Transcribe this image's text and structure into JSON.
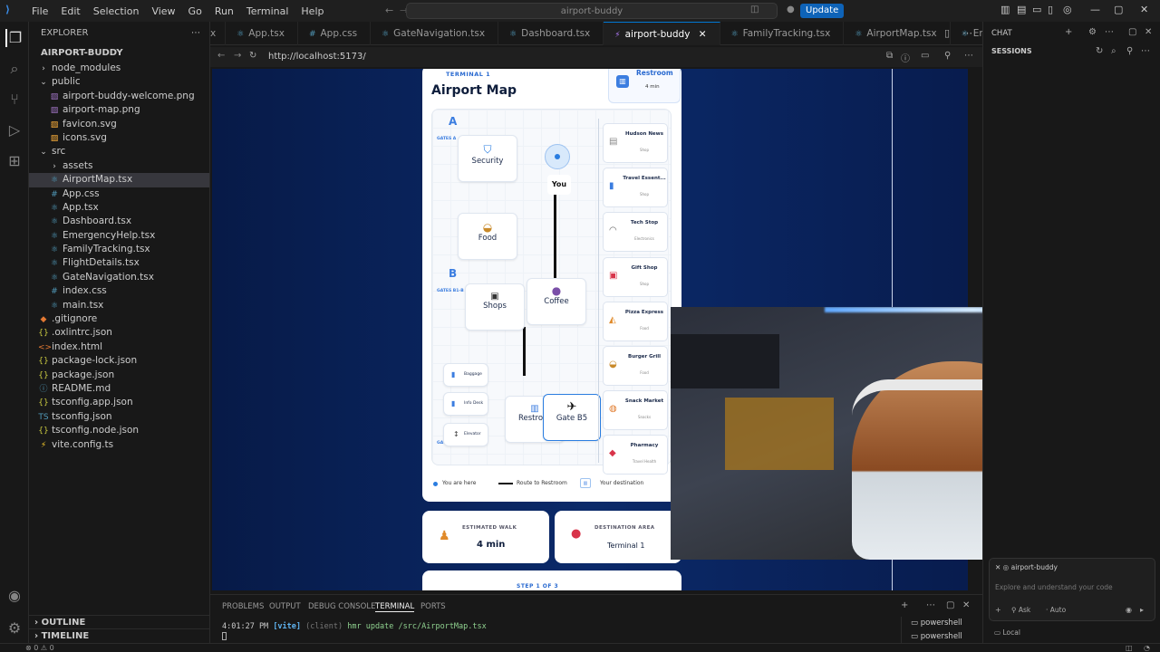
{
  "titlebar": {
    "menu": [
      "File",
      "Edit",
      "Selection",
      "View",
      "Go",
      "Run",
      "Terminal",
      "Help"
    ],
    "search": "airport-buddy",
    "update": "Update"
  },
  "explorer": {
    "header": "EXPLORER",
    "project": "AIRPORT-BUDDY",
    "items": [
      {
        "label": "node_modules",
        "depth": 1,
        "kind": "folder-closed"
      },
      {
        "label": "public",
        "depth": 1,
        "kind": "folder-open"
      },
      {
        "label": "airport-buddy-welcome.png",
        "depth": 2,
        "kind": "image"
      },
      {
        "label": "airport-map.png",
        "depth": 2,
        "kind": "image"
      },
      {
        "label": "favicon.svg",
        "depth": 2,
        "kind": "svg"
      },
      {
        "label": "icons.svg",
        "depth": 2,
        "kind": "svg"
      },
      {
        "label": "src",
        "depth": 1,
        "kind": "folder-open"
      },
      {
        "label": "assets",
        "depth": 2,
        "kind": "folder-closed"
      },
      {
        "label": "AirportMap.tsx",
        "depth": 2,
        "kind": "tsx",
        "active": true
      },
      {
        "label": "App.css",
        "depth": 2,
        "kind": "css"
      },
      {
        "label": "App.tsx",
        "depth": 2,
        "kind": "tsx"
      },
      {
        "label": "Dashboard.tsx",
        "depth": 2,
        "kind": "tsx"
      },
      {
        "label": "EmergencyHelp.tsx",
        "depth": 2,
        "kind": "tsx"
      },
      {
        "label": "FamilyTracking.tsx",
        "depth": 2,
        "kind": "tsx"
      },
      {
        "label": "FlightDetails.tsx",
        "depth": 2,
        "kind": "tsx"
      },
      {
        "label": "GateNavigation.tsx",
        "depth": 2,
        "kind": "tsx"
      },
      {
        "label": "index.css",
        "depth": 2,
        "kind": "css"
      },
      {
        "label": "main.tsx",
        "depth": 2,
        "kind": "tsx"
      },
      {
        "label": ".gitignore",
        "depth": 1,
        "kind": "git"
      },
      {
        "label": ".oxlintrc.json",
        "depth": 1,
        "kind": "json"
      },
      {
        "label": "index.html",
        "depth": 1,
        "kind": "html"
      },
      {
        "label": "package-lock.json",
        "depth": 1,
        "kind": "json"
      },
      {
        "label": "package.json",
        "depth": 1,
        "kind": "json"
      },
      {
        "label": "README.md",
        "depth": 1,
        "kind": "md"
      },
      {
        "label": "tsconfig.app.json",
        "depth": 1,
        "kind": "json"
      },
      {
        "label": "tsconfig.json",
        "depth": 1,
        "kind": "ts"
      },
      {
        "label": "tsconfig.node.json",
        "depth": 1,
        "kind": "json"
      },
      {
        "label": "vite.config.ts",
        "depth": 1,
        "kind": "vite"
      }
    ],
    "outline": "OUTLINE",
    "timeline": "TIMELINE"
  },
  "tabs": [
    {
      "label": "x",
      "kind": "css"
    },
    {
      "label": "App.tsx",
      "kind": "tsx"
    },
    {
      "label": "App.css",
      "kind": "css"
    },
    {
      "label": "GateNavigation.tsx",
      "kind": "tsx"
    },
    {
      "label": "Dashboard.tsx",
      "kind": "tsx"
    },
    {
      "label": "airport-buddy",
      "kind": "vite",
      "active": true
    },
    {
      "label": "FamilyTracking.tsx",
      "kind": "tsx"
    },
    {
      "label": "AirportMap.tsx",
      "kind": "tsx"
    },
    {
      "label": "EmergencyHelp.tsx",
      "kind": "tsx"
    }
  ],
  "browser": {
    "url": "http://localhost:5173/"
  },
  "app": {
    "terminal_label": "TERMINAL 1",
    "map_title": "Airport Map",
    "top_dest": {
      "name": "Restroom",
      "time": "4 min"
    },
    "zone_a": "A",
    "zone_a_sub": "GATES A",
    "zone_b": "B",
    "zone_b_sub": "GATES B1-B",
    "zone_g_sub": "GA",
    "pois": {
      "security": "Security",
      "you": "You",
      "food": "Food",
      "shops": "Shops",
      "coffee": "Coffee",
      "restroom": "Restro",
      "gate": "Gate B5",
      "baggage": "Baggage",
      "info": "Info Desk",
      "elevator": "Elevator"
    },
    "shops": [
      {
        "name": "Hudson News",
        "sub": "Shop",
        "icon": "▤"
      },
      {
        "name": "Travel Essent...",
        "sub": "Shop",
        "icon": "▮"
      },
      {
        "name": "Tech Stop",
        "sub": "Electronics",
        "icon": "◠"
      },
      {
        "name": "Gift Shop",
        "sub": "Shop",
        "icon": "▣"
      },
      {
        "name": "Pizza Express",
        "sub": "Food",
        "icon": "◭"
      },
      {
        "name": "Burger Grill",
        "sub": "Food",
        "icon": "◒"
      },
      {
        "name": "Snack Market",
        "sub": "Snacks",
        "icon": "◍"
      },
      {
        "name": "Pharmacy",
        "sub": "Travel Health",
        "icon": "◆"
      }
    ],
    "legend": {
      "here": "You are here",
      "route": "Route to Restroom",
      "dest": "Your destination"
    },
    "walk": {
      "label": "ESTIMATED WALK",
      "value": "4 min"
    },
    "dest_area": {
      "label": "DESTINATION AREA",
      "value": "Terminal 1"
    },
    "step": "STEP 1 OF 3"
  },
  "panel": {
    "tabs": [
      "PROBLEMS",
      "OUTPUT",
      "DEBUG CONSOLE",
      "TERMINAL",
      "PORTS"
    ],
    "log_time": "4:01:27 PM",
    "log_tag": "[vite]",
    "log_client": "(client)",
    "log_msg": "hmr update /src/AirportMap.tsx",
    "shells": [
      "powershell",
      "powershell"
    ]
  },
  "chat": {
    "title": "CHAT",
    "sessions": "SESSIONS",
    "chip": "airport-buddy",
    "placeholder": "Explore and understand your code",
    "mode": "Ask",
    "model": "Auto",
    "local": "Local"
  },
  "status": {
    "left": "⊗ 0 ⚠ 0"
  },
  "colors": {
    "accent": "#0078d4",
    "route": "#111111",
    "map_blue": "#1e6fd9"
  }
}
